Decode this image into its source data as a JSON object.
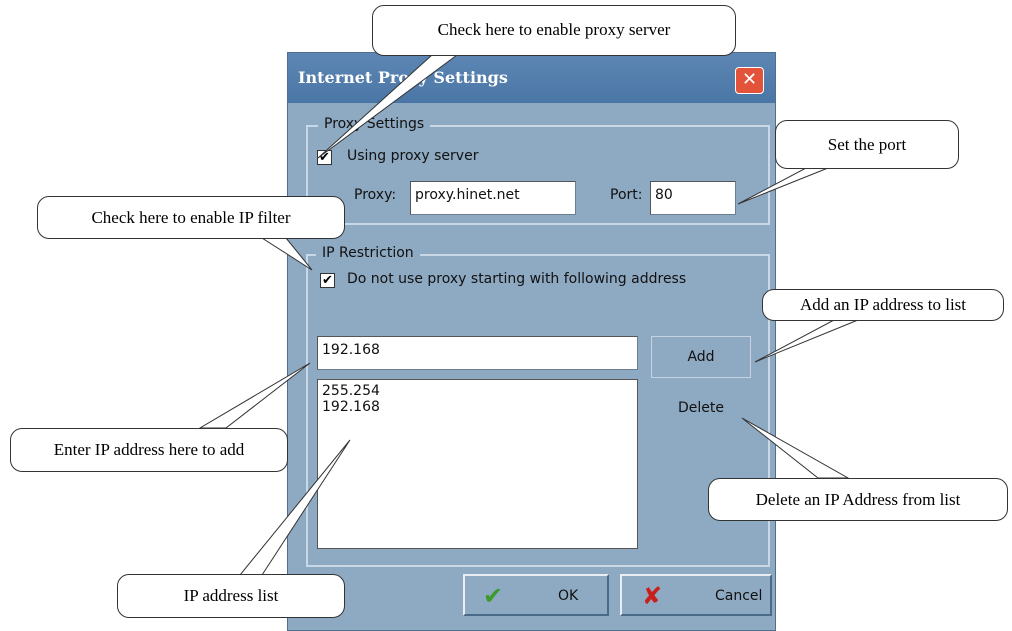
{
  "dialog": {
    "title": "Internet Proxy Settings",
    "close_label": "✕",
    "proxy_group_label": "Proxy Settings",
    "use_proxy_label": "Using proxy server",
    "use_proxy_checked": true,
    "proxy_label": "Proxy:",
    "proxy_value": "proxy.hinet.net",
    "port_label": "Port:",
    "port_value": "80",
    "ip_group_label": "IP Restriction",
    "ip_restrict_label": "Do not use proxy starting with following address",
    "ip_restrict_checked": true,
    "ip_input_value": "192.168",
    "add_label": "Add",
    "delete_label": "Delete",
    "ip_list": [
      "255.254",
      "192.168"
    ],
    "ok_label": "OK",
    "cancel_label": "Cancel",
    "check_glyph": "✔",
    "ok_glyph": "✔",
    "cancel_glyph": "✘"
  },
  "callouts": {
    "enable_proxy": "Check here to enable proxy server",
    "set_port": "Set the port",
    "enable_filter": "Check here to enable IP filter",
    "add_to_list": "Add an IP address to list",
    "enter_ip": "Enter IP address here to add",
    "delete_from_list": "Delete an IP Address from list",
    "ip_list": "IP address list"
  },
  "colors": {
    "dialog_bg": "#8ea9c2",
    "titlebar": "#4a76a6",
    "close": "#e2533a",
    "ok_check": "#3c9a2e",
    "cancel_x": "#c8201a"
  }
}
